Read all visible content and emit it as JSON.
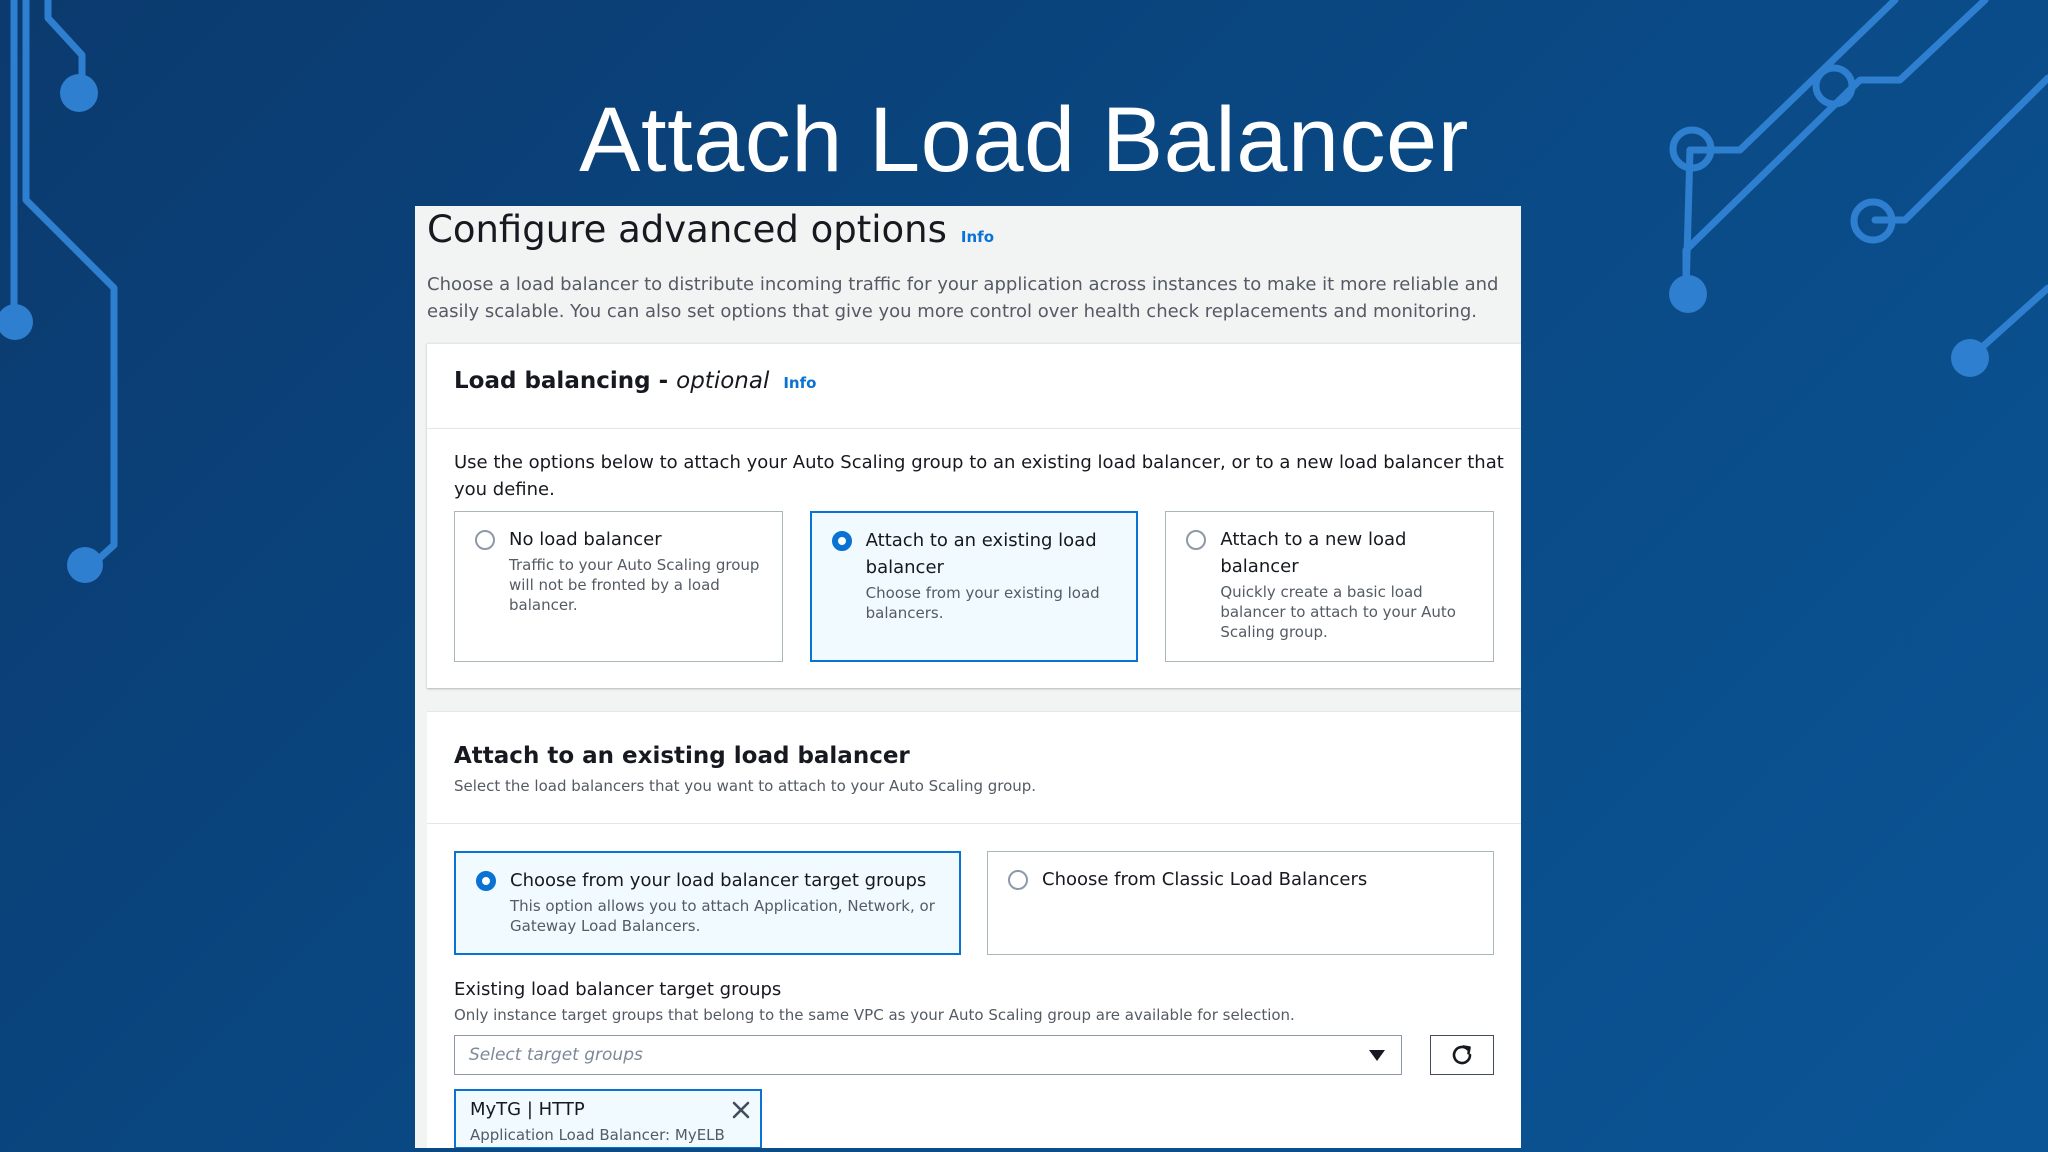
{
  "slide": {
    "title": "Attach Load Balancer"
  },
  "page": {
    "heading": "Configure advanced options",
    "heading_info": "Info",
    "description": "Choose a load balancer to distribute incoming traffic for your application across instances to make it more reliable and easily scalable. You can also set options that give you more control over health check replacements and monitoring."
  },
  "load_balancing": {
    "title": "Load balancing -",
    "title_optional": "optional",
    "info": "Info",
    "instructions": "Use the options below to attach your Auto Scaling group to an existing load balancer, or to a new load balancer that you define.",
    "options": [
      {
        "label": "No load balancer",
        "description": "Traffic to your Auto Scaling group will not be fronted by a load balancer.",
        "selected": false
      },
      {
        "label": "Attach to an existing load balancer",
        "description": "Choose from your existing load balancers.",
        "selected": true
      },
      {
        "label": "Attach to a new load balancer",
        "description": "Quickly create a basic load balancer to attach to your Auto Scaling group.",
        "selected": false
      }
    ]
  },
  "existing_lb": {
    "title": "Attach to an existing load balancer",
    "subtitle": "Select the load balancers that you want to attach to your Auto Scaling group.",
    "options": [
      {
        "label": "Choose from your load balancer target groups",
        "description": "This option allows you to attach Application, Network, or Gateway Load Balancers.",
        "selected": true
      },
      {
        "label": "Choose from Classic Load Balancers",
        "description": "",
        "selected": false
      }
    ],
    "field_label": "Existing load balancer target groups",
    "field_description": "Only instance target groups that belong to the same VPC as your Auto Scaling group are available for selection.",
    "select_placeholder": "Select target groups",
    "token": {
      "title": "MyTG | HTTP",
      "description": "Application Load Balancer: MyELB"
    }
  },
  "colors": {
    "background": "#0b4a86",
    "circuit": "#2b7fd0",
    "accent": "#0972d3"
  },
  "icons": [
    "chevron-down-icon",
    "refresh-icon",
    "close-icon",
    "radio-selected-icon",
    "radio-unselected-icon"
  ]
}
